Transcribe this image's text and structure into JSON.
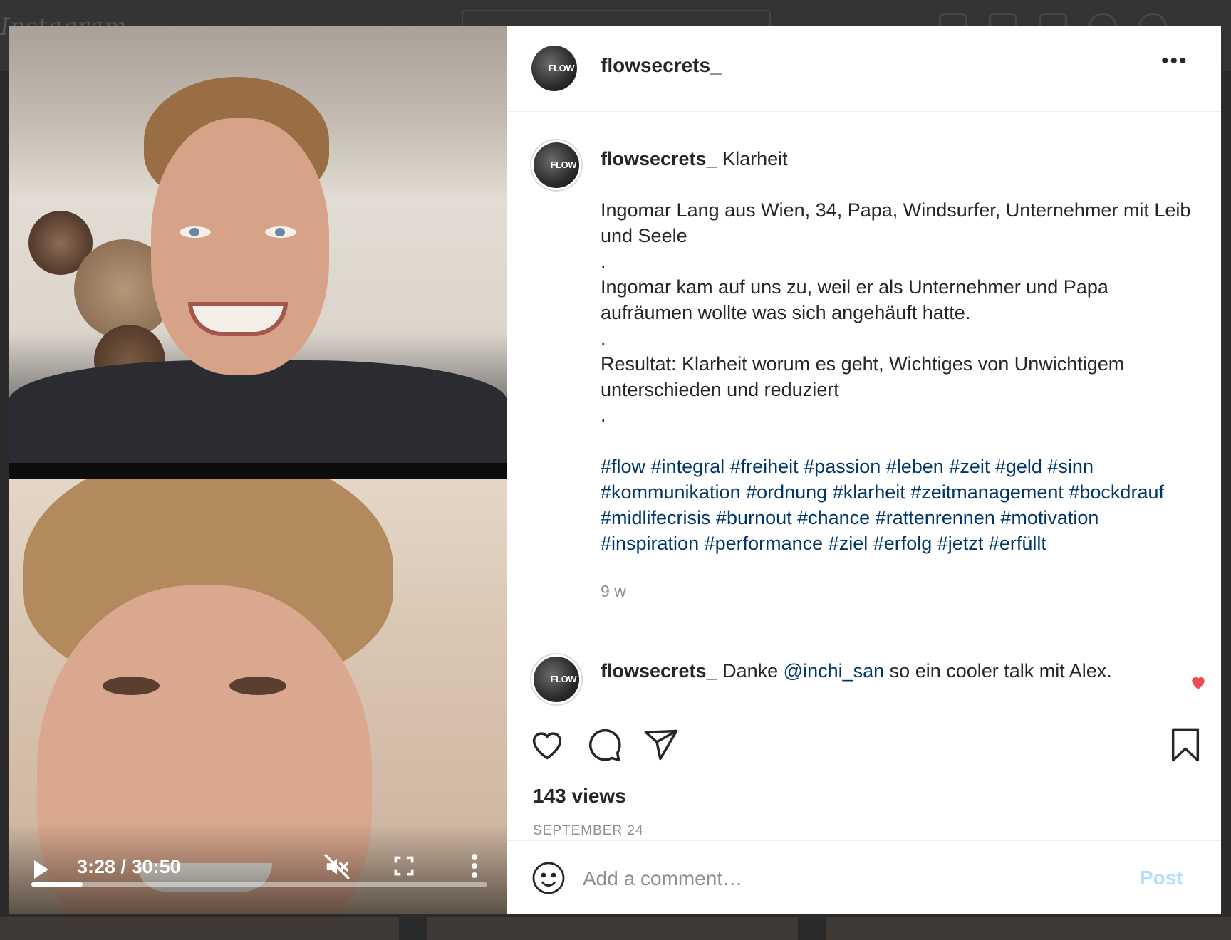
{
  "background": {
    "logo_text": "Instagram"
  },
  "post": {
    "username": "flowsecrets_",
    "avatar_text": "FLOW",
    "more_label": "•••",
    "caption": {
      "username": "flowsecrets_",
      "title": "Klarheit",
      "line1": "Ingomar Lang aus Wien, 34, Papa, Windsurfer, Unternehmer mit Leib und Seele",
      "dot1": ".",
      "line2": "Ingomar kam auf uns zu, weil er als Unternehmer und Papa aufräumen wollte was sich angehäuft hatte.",
      "dot2": ".",
      "line3": "Resultat: Klarheit worum es geht, Wichtiges von Unwichtigem unterschieden und reduziert",
      "dot3": ".",
      "hashtags": "#flow #integral #freiheit #passion #leben #zeit #geld #sinn #kommunikation #ordnung #klarheit #zeitmanagement #bockdrauf #midlifecrisis #burnout #chance #rattenrennen #motivation #inspiration #performance #ziel #erfolg #jetzt #erfüllt",
      "age": "9 w"
    },
    "comment2": {
      "username": "flowsecrets_",
      "pre": "Danke ",
      "mention": "@inchi_san",
      "post": " so ein cooler talk mit Alex."
    },
    "views": "143 views",
    "date": "SEPTEMBER 24",
    "add_comment_placeholder": "Add a comment…",
    "post_button": "Post"
  },
  "video": {
    "time": "3:28 / 30:50",
    "progress": 0.113
  },
  "colors": {
    "link": "#00376b",
    "post_disabled": "#b2dffc",
    "like_red": "#ed4956"
  },
  "icons": [
    "heart-icon",
    "comment-icon",
    "share-icon",
    "bookmark-icon",
    "emoji-icon",
    "play-icon",
    "mute-icon",
    "fullscreen-icon",
    "more-vertical-icon"
  ]
}
